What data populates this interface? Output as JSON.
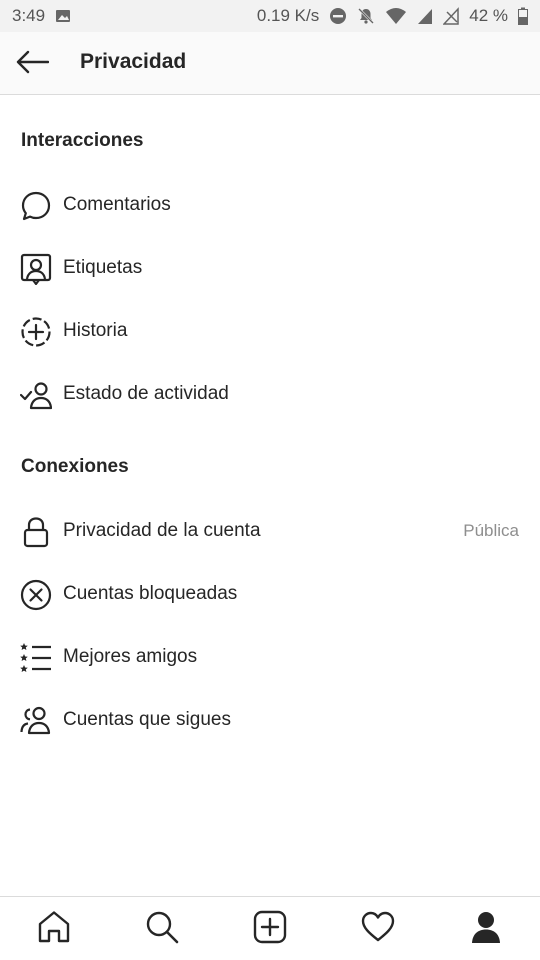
{
  "status_bar": {
    "time": "3:49",
    "speed": "0.19 K/s",
    "battery": "42 %"
  },
  "header": {
    "title": "Privacidad",
    "back_icon": "arrow-left-icon"
  },
  "sections": [
    {
      "title": "Interacciones",
      "items": [
        {
          "label": "Comentarios",
          "icon": "comment-icon"
        },
        {
          "label": "Etiquetas",
          "icon": "tag-person-icon"
        },
        {
          "label": "Historia",
          "icon": "story-add-icon"
        },
        {
          "label": "Estado de actividad",
          "icon": "activity-status-icon"
        }
      ]
    },
    {
      "title": "Conexiones",
      "items": [
        {
          "label": "Privacidad de la cuenta",
          "icon": "lock-icon",
          "value": "Pública"
        },
        {
          "label": "Cuentas bloqueadas",
          "icon": "blocked-icon"
        },
        {
          "label": "Mejores amigos",
          "icon": "close-friends-list-icon"
        },
        {
          "label": "Cuentas que sigues",
          "icon": "following-accounts-icon"
        }
      ]
    }
  ],
  "tabs": [
    {
      "icon": "home-icon"
    },
    {
      "icon": "search-icon"
    },
    {
      "icon": "new-post-icon"
    },
    {
      "icon": "heart-icon"
    },
    {
      "icon": "profile-icon"
    }
  ],
  "colors": {
    "text": "#262626",
    "secondary": "#8e8e8e",
    "divider": "#dbdbdb",
    "header_bg": "#fafafa",
    "status_bg": "#f2f2f2"
  }
}
